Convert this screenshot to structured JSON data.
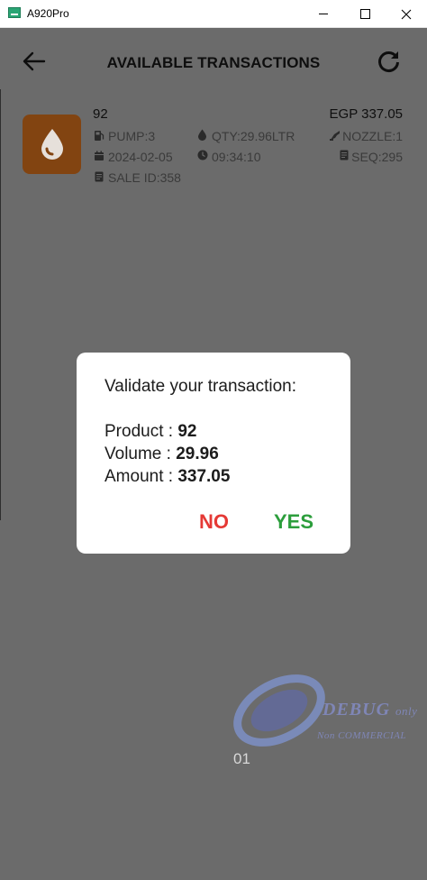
{
  "window": {
    "title": "A920Pro"
  },
  "header": {
    "title": "AVAILABLE TRANSACTIONS"
  },
  "transaction": {
    "product": "92",
    "amount": "EGP 337.05",
    "pump": "PUMP:3",
    "quantity": "QTY:29.96LTR",
    "nozzle": "NOZZLE:1",
    "date": "2024-02-05",
    "time": "09:34:10",
    "sequence": "SEQ:295",
    "sale_id": "SALE ID:358"
  },
  "dialog": {
    "title": "Validate your transaction:",
    "product_label": "Product : ",
    "product_value": "92",
    "volume_label": "Volume : ",
    "volume_value": "29.96",
    "amount_label": "Amount : ",
    "amount_value": "337.05",
    "no_label": "NO",
    "yes_label": "YES"
  },
  "watermark": {
    "text": "DEBUG",
    "suffix": "only",
    "subtext": "Non COMMERCIAL"
  },
  "footer": {
    "version": "01"
  },
  "colors": {
    "overlay": "#6b6b6b",
    "fuel_icon_bg": "#824411",
    "no_button": "#e53935",
    "yes_button": "#2c9e3c"
  }
}
